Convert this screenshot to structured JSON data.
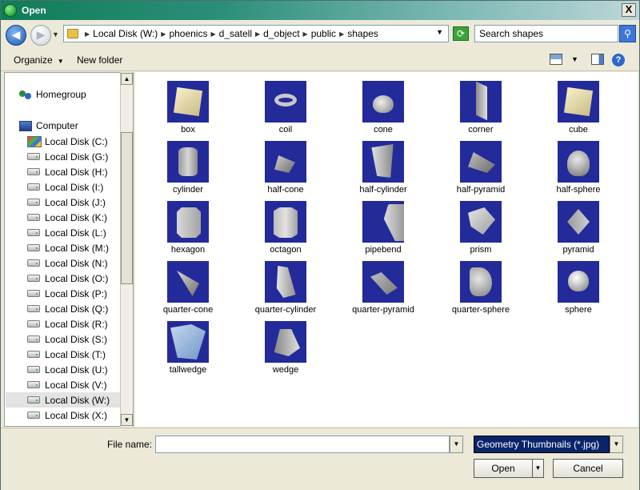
{
  "window": {
    "title": "Open",
    "close_label": "X"
  },
  "address": {
    "crumbs": [
      "Local Disk (W:)",
      "phoenics",
      "d_satell",
      "d_object",
      "public",
      "shapes"
    ],
    "search_placeholder": "Search shapes"
  },
  "toolbar": {
    "organize": "Organize",
    "new_folder": "New folder"
  },
  "nav": {
    "homegroup": "Homegroup",
    "computer": "Computer",
    "drives": [
      "Local Disk (C:)",
      "Local Disk (G:)",
      "Local Disk (H:)",
      "Local Disk (I:)",
      "Local Disk (J:)",
      "Local Disk (K:)",
      "Local Disk (L:)",
      "Local Disk (M:)",
      "Local Disk (N:)",
      "Local Disk (O:)",
      "Local Disk (P:)",
      "Local Disk (Q:)",
      "Local Disk (R:)",
      "Local Disk (S:)",
      "Local Disk (T:)",
      "Local Disk (U:)",
      "Local Disk (V:)",
      "Local Disk (W:)",
      "Local Disk (X:)"
    ],
    "selected_drive": "Local Disk (W:)"
  },
  "files": [
    "box",
    "coil",
    "cone",
    "corner",
    "cube",
    "cylinder",
    "half-cone",
    "half-cylinder",
    "half-pyramid",
    "half-sphere",
    "hexagon",
    "octagon",
    "pipebend",
    "prism",
    "pyramid",
    "quarter-cone",
    "quarter-cylinder",
    "quarter-pyramid",
    "quarter-sphere",
    "sphere",
    "tallwedge",
    "wedge"
  ],
  "bottom": {
    "file_name_label": "File name:",
    "file_name_value": "",
    "filter": "Geometry Thumbnails (*.jpg)",
    "open_label": "Open",
    "cancel_label": "Cancel"
  },
  "colors": {
    "thumb_bg": "#232a9a",
    "title_start": "#0f7d57",
    "selection": "#0a246a"
  }
}
